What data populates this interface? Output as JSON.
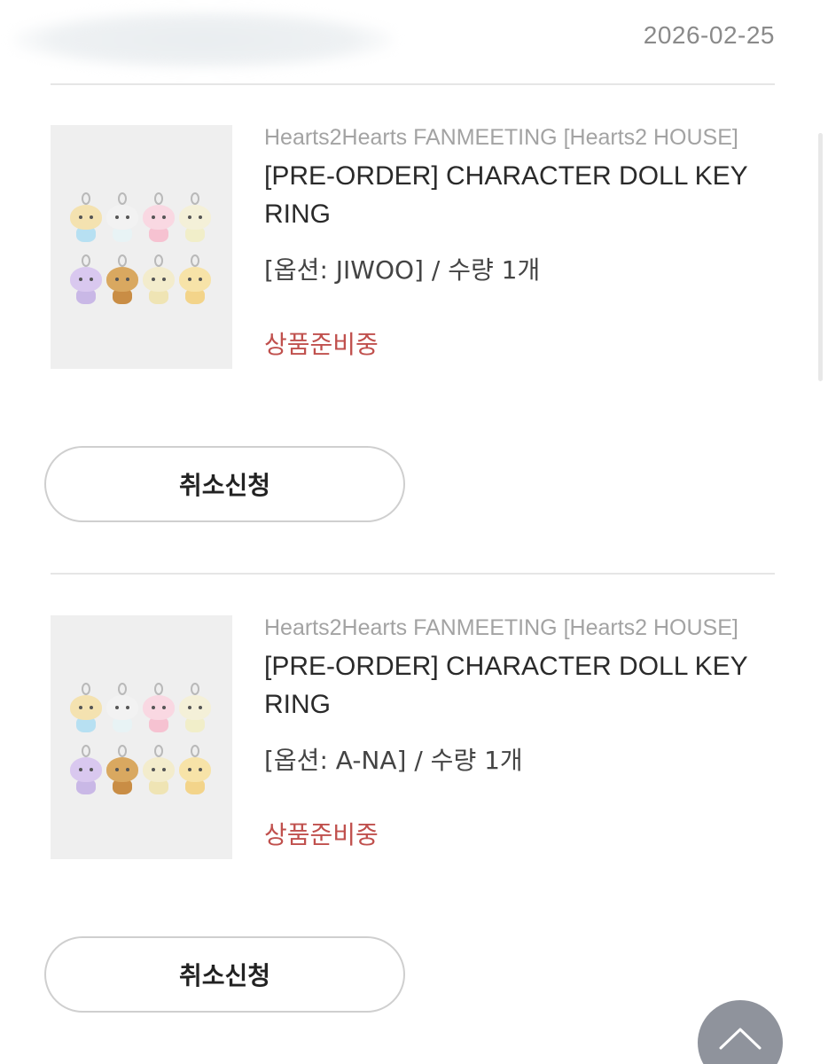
{
  "order": {
    "date": "2026-02-25"
  },
  "items": [
    {
      "brand": "Hearts2Hearts FANMEETING [Hearts2 HOUSE]",
      "title": "[PRE-ORDER] CHARACTER DOLL KEY RING",
      "option": "[옵션: JIWOO] / 수량 1개",
      "status": "상품준비중",
      "cancel_label": "취소신청"
    },
    {
      "brand": "Hearts2Hearts FANMEETING [Hearts2 HOUSE]",
      "title": "[PRE-ORDER] CHARACTER DOLL KEY RING",
      "option": "[옵션: A-NA] / 수량 1개",
      "status": "상품준비중",
      "cancel_label": "취소신청"
    }
  ],
  "colors": {
    "status": "#c0504d",
    "brand_text": "#a3a3a3",
    "divider": "#e6e6e6",
    "top_button": "#8f939c"
  },
  "icons": {
    "scroll_top": "chevron-up-icon"
  }
}
